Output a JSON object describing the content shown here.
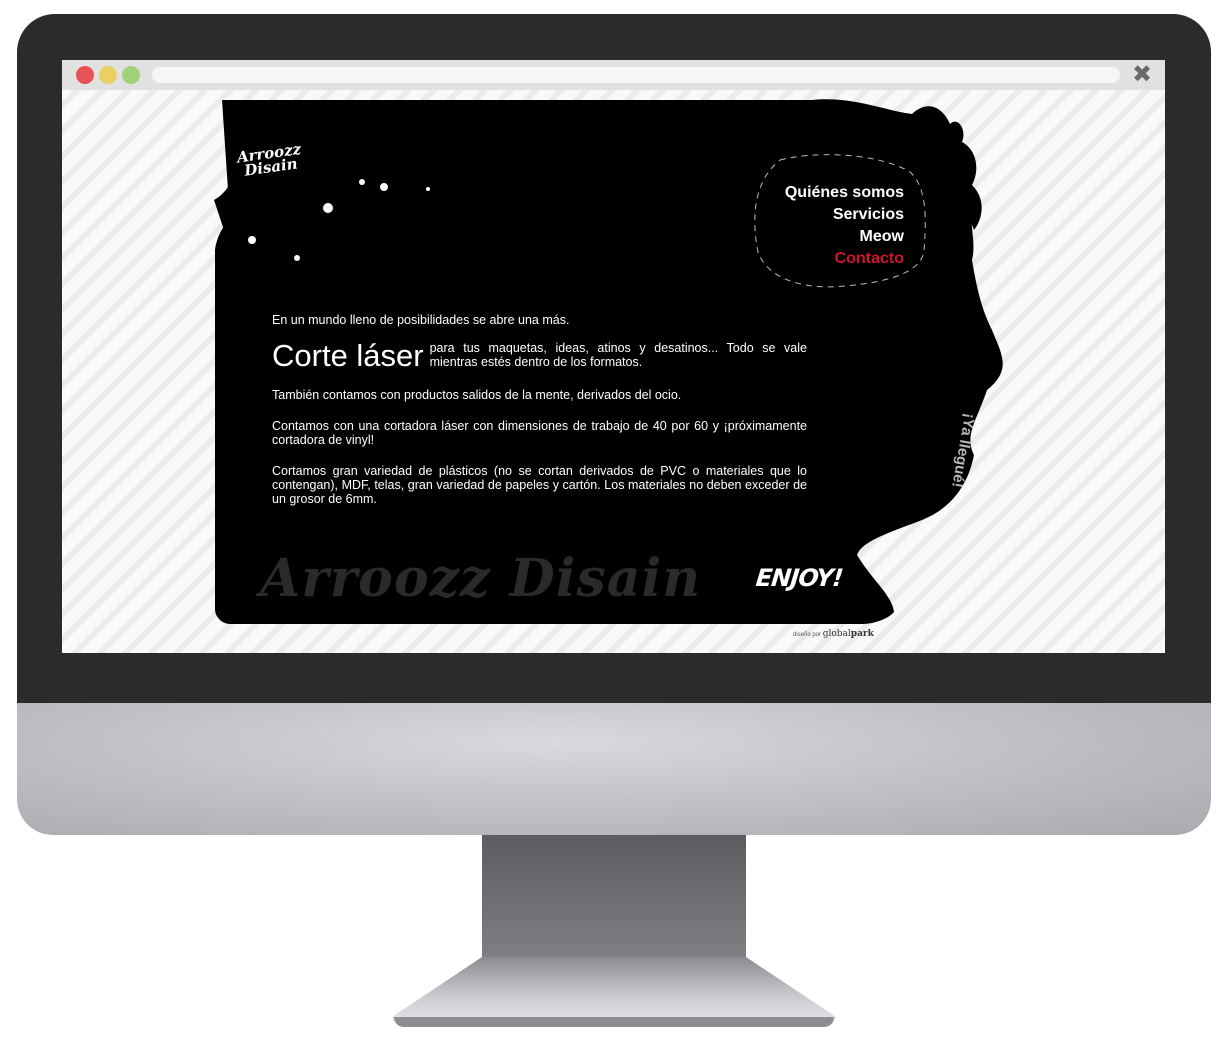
{
  "browser": {
    "url": "",
    "controls": [
      "close-dot",
      "minimize-dot",
      "maximize-dot"
    ],
    "close_icon": "✖"
  },
  "site": {
    "logo": {
      "line1": "Arroozz",
      "line2": "Disain"
    },
    "nav": {
      "items": [
        {
          "label": "Quiénes somos",
          "active": false
        },
        {
          "label": "Servicios",
          "active": false
        },
        {
          "label": "Meow",
          "active": false
        },
        {
          "label": "Contacto",
          "active": true
        }
      ]
    },
    "content": {
      "intro": "En un mundo lleno de posibilidades se abre una más.",
      "headline": "Corte láser",
      "headline_desc": "para tus maquetas, ideas, atinos y desatinos... Todo se vale mientras estés dentro de los formatos.",
      "para1": "También contamos con productos salidos de la mente, derivados del ocio.",
      "para2": "Contamos con una cortadora láser con dimensiones de trabajo de 40 por 60 y ¡próximamente cortadora de vinyl!",
      "para3": "Cortamos gran variedad de plásticos (no se cortan derivados de PVC o materiales que lo contengan), MDF, telas, gran variedad de papeles y cartón. Los materiales no deben exceder de un grosor de 6mm."
    },
    "watermark": "Arroozz Disain",
    "enjoy": "ENJOY!",
    "side_text": "¡Ya llegué!",
    "credit": {
      "prefix": "diseño por",
      "brand_light": "global",
      "brand_bold": "park"
    }
  },
  "colors": {
    "accent": "#d0142c",
    "panel": "#000000",
    "bezel": "#2b2b2c"
  }
}
